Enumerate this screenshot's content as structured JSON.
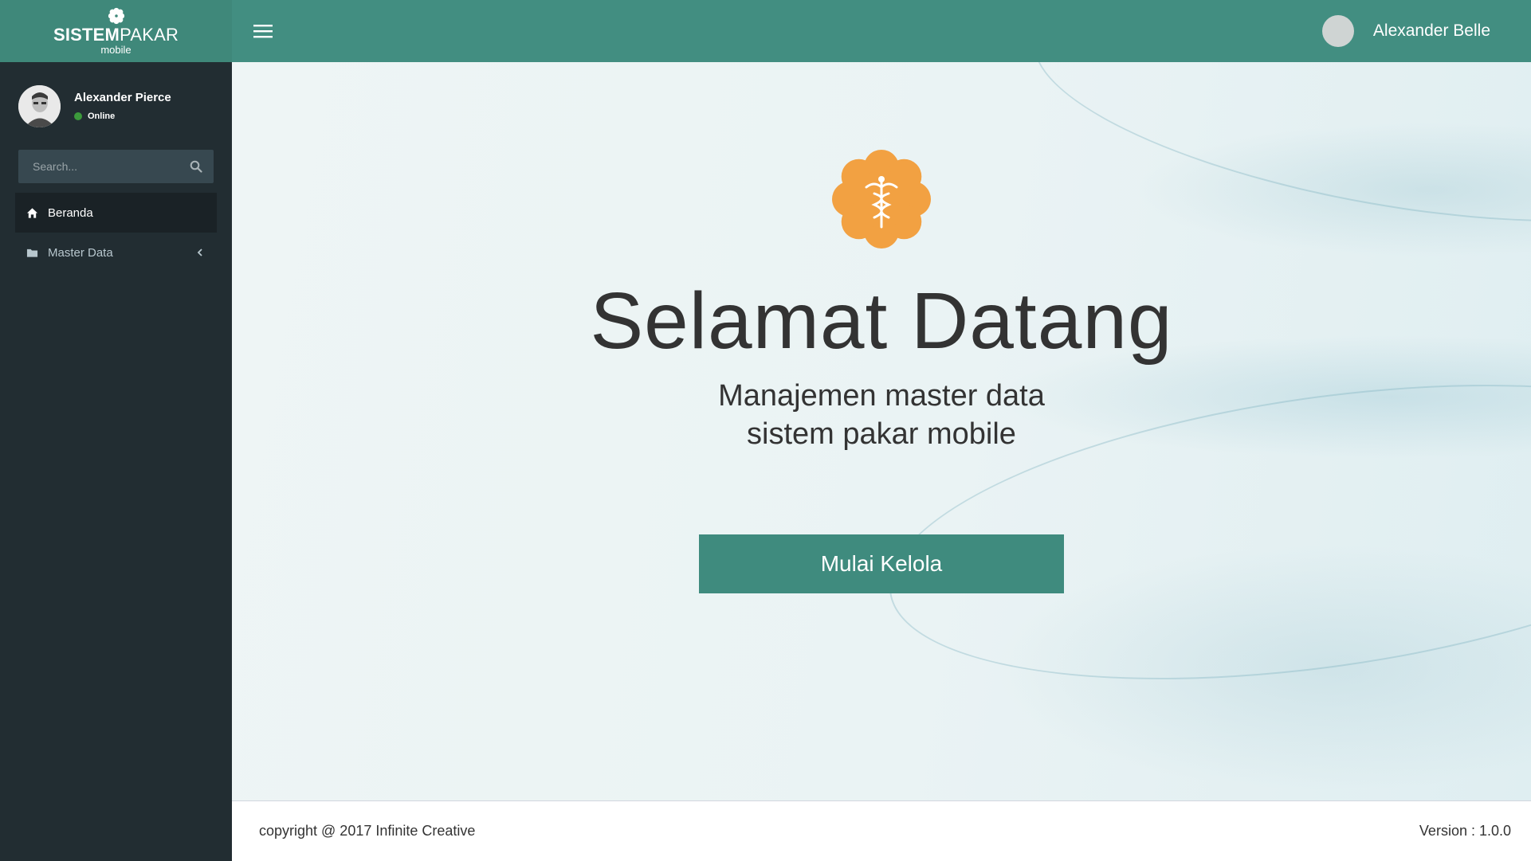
{
  "brand": {
    "title_bold": "SISTEM",
    "title_regular": "PAKAR",
    "subtitle": "mobile"
  },
  "sidebar": {
    "user": {
      "name": "Alexander Pierce",
      "status": "Online"
    },
    "search": {
      "placeholder": "Search..."
    },
    "items": [
      {
        "label": "Beranda",
        "icon": "home-icon",
        "active": true
      },
      {
        "label": "Master Data",
        "icon": "folder-icon",
        "active": false
      }
    ]
  },
  "header": {
    "user_name": "Alexander Belle"
  },
  "main": {
    "title": "Selamat Datang",
    "subtitle_line1": "Manajemen master data",
    "subtitle_line2": "sistem pakar mobile",
    "button_label": "Mulai Kelola"
  },
  "footer": {
    "copyright": "copyright @ 2017 Infinite Creative",
    "version": "Version : 1.0.0"
  },
  "colors": {
    "header": "#428e81",
    "sidebar": "#222d32",
    "accent_orange": "#f2a142",
    "button": "#3f8b7e"
  }
}
